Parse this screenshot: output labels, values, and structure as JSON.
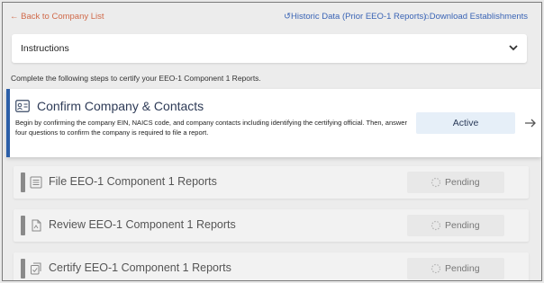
{
  "nav": {
    "back_label": "← Back to Company List",
    "historic_label": "Historic Data (Prior EEO-1 Reports)",
    "download_label": "Download Establishments"
  },
  "instructions": {
    "title": "Instructions",
    "intro": "Complete the following steps to certify your EEO-1 Component 1 Reports."
  },
  "steps": [
    {
      "title": "Confirm Company & Contacts",
      "description": "Begin by confirming the company EIN, NAICS code, and company contacts including identifying the certifying official. Then, answer four questions to confirm the company is required to file a report.",
      "status": "Active",
      "icon": "id-card-icon"
    },
    {
      "title": "File EEO-1 Component 1 Reports",
      "status": "Pending",
      "icon": "list-icon"
    },
    {
      "title": "Review EEO-1 Component 1 Reports",
      "status": "Pending",
      "icon": "document-icon"
    },
    {
      "title": "Certify EEO-1 Component 1 Reports",
      "status": "Pending",
      "icon": "certify-icon"
    }
  ],
  "colors": {
    "active_accent": "#2c5fa8",
    "link": "#3a64b5",
    "back_link": "#d06a4a",
    "pending_bar": "#8a8a8a"
  }
}
